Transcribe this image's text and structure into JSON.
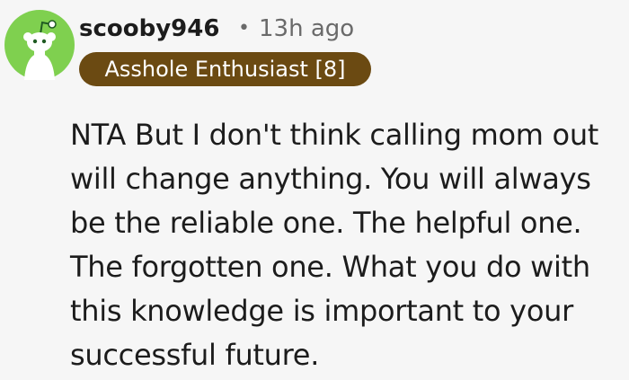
{
  "comment": {
    "author": {
      "username": "scooby946",
      "avatar_icon": "snoo-avatar-icon",
      "avatar_color": "#7fd04f"
    },
    "separator": "•",
    "timestamp": "13h ago",
    "flair": {
      "text": "Asshole Enthusiast [8]",
      "background_color": "#6b4a12"
    },
    "body": "NTA But I don't think calling mom out will change anything. You will always be the reliable one. The helpful one. The forgotten one. What you do with this knowledge is important to your successful future."
  }
}
